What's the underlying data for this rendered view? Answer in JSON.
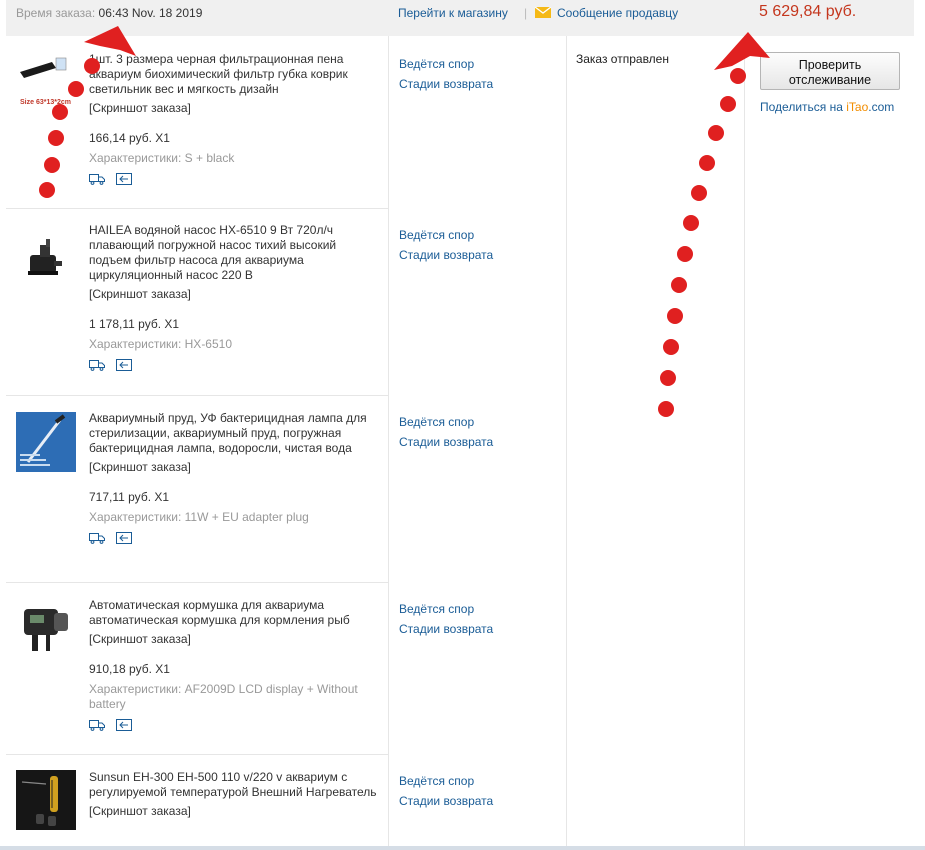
{
  "header": {
    "order_time_label": "Время заказа:",
    "order_time_value": "06:43 Nov. 18 2019",
    "store_link": "Перейти к магазину",
    "separator": "|",
    "message_seller": "Сообщение продавцу",
    "total": "5 629,84 руб."
  },
  "order": {
    "status": "Заказ отправлен",
    "track_button": "Проверить отслеживание",
    "share_prefix": "Поделиться на ",
    "share_brand_a": "i",
    "share_brand_b": "Tao",
    "share_brand_c": ".com"
  },
  "actions": {
    "dispute": "Ведётся спор",
    "return_stages": "Стадии возврата"
  },
  "items": [
    {
      "title": "1шт. 3 размера черная фильтрационная пена аквариум биохимический фильтр губка коврик светильник вес и мягкость дизайн",
      "screenshot": "[Скриншот заказа]",
      "price": "166,14 руб. X1",
      "specs": "Характеристики: S + black",
      "thumb_caption": "Size 63*13*2cm"
    },
    {
      "title": "HAILEA водяной насос HX-6510 9 Вт 720л/ч плавающий погружной насос тихий высокий подъем фильтр насоса для аквариума циркуляционный насос 220 В",
      "screenshot": "[Скриншот заказа]",
      "price": "1 178,11 руб. X1",
      "specs": "Характеристики: HX-6510"
    },
    {
      "title": "Аквариумный пруд, УФ бактерицидная лампа для стерилизации, аквариумный пруд, погружная бактерицидная лампа, водоросли, чистая вода",
      "screenshot": "[Скриншот заказа]",
      "price": "717,11 руб. X1",
      "specs": "Характеристики: 11W + EU adapter plug"
    },
    {
      "title": "Автоматическая кормушка для аквариума автоматическая кормушка для кормления рыб",
      "screenshot": "[Скриншот заказа]",
      "price": "910,18 руб. X1",
      "specs": "Характеристики: AF2009D LCD display + Without battery"
    },
    {
      "title": "Sunsun EH-300 EH-500 110 v/220 v аквариум с регулируемой температурой Внешний Нагреватель",
      "screenshot": "[Скриншот заказа]"
    }
  ],
  "icons": {
    "delivery": "truck-icon",
    "return": "return-icon",
    "mail": "envelope-icon"
  },
  "colors": {
    "link": "#1a5c96",
    "price_total": "#c4361d",
    "annotation": "#e02020",
    "muted": "#999999"
  }
}
